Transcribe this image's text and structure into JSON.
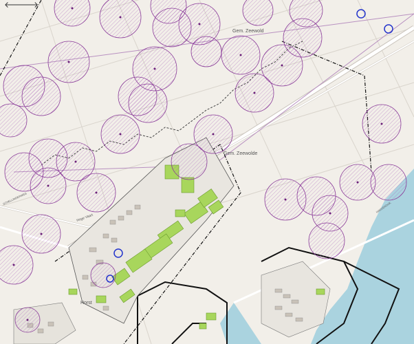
{
  "toolbar": {
    "back_icon": "arrow-left-icon",
    "back_glyph": "🡐",
    "forward_icon": "arrow-right-icon",
    "forward_glyph": "🡒"
  },
  "labels": {
    "gem_zeewolde_north": "Gem. Zeewold",
    "gem_zeewolde": "Gem. Zeewolde",
    "horst": "Horst",
    "hogeweg": "Hoge Vaart",
    "schellingweg": "SCHELLINGERWEG",
    "harderdijk": "HARDERDIJK"
  },
  "colors": {
    "land": "#f2efe9",
    "water": "#aad3df",
    "buffer_fill": "#c97bd6",
    "buffer_stroke": "#8a3b99",
    "industrial": "#a8d65c",
    "boundary": "#111111",
    "road": "#ffffff"
  }
}
